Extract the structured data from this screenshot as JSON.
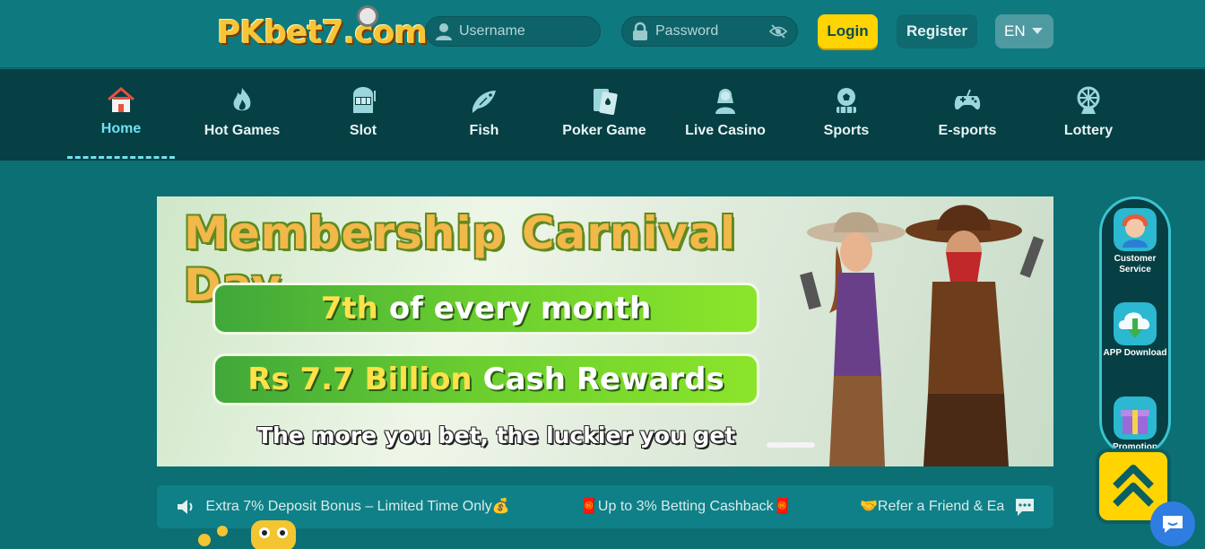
{
  "header": {
    "logo": "PKbet7.com",
    "username_placeholder": "Username",
    "password_placeholder": "Password",
    "login_label": "Login",
    "register_label": "Register",
    "language": "EN"
  },
  "nav": {
    "items": [
      {
        "label": "Home",
        "icon": "home-icon",
        "active": true
      },
      {
        "label": "Hot Games",
        "icon": "flame-icon"
      },
      {
        "label": "Slot",
        "icon": "slot-machine-icon"
      },
      {
        "label": "Fish",
        "icon": "fish-icon"
      },
      {
        "label": "Poker Game",
        "icon": "poker-card-icon"
      },
      {
        "label": "Live Casino",
        "icon": "dealer-icon"
      },
      {
        "label": "Sports",
        "icon": "soccer-ball-icon"
      },
      {
        "label": "E-sports",
        "icon": "gamepad-icon"
      },
      {
        "label": "Lottery",
        "icon": "lottery-wheel-icon"
      }
    ]
  },
  "banner": {
    "title": "Membership Carnival Day",
    "line1_highlight": "7th",
    "line1_rest": "of every month",
    "line2_highlight": "Rs 7.7 Billion",
    "line2_rest": "Cash Rewards",
    "subtitle": "The more you bet, the luckier you get"
  },
  "marquee": {
    "items": [
      "​ Extra 7% Deposit Bonus – Limited Time Only💰",
      "🧧Up to 3% Betting Cashback🧧",
      "🤝Refer a Friend & Ea"
    ]
  },
  "side_panel": {
    "items": [
      {
        "label": "Customer Service",
        "icon": "customer-service-icon"
      },
      {
        "label": "APP Download",
        "icon": "app-download-icon"
      },
      {
        "label": "Promotion",
        "icon": "promotion-gift-icon"
      }
    ]
  },
  "colors": {
    "page_bg": "#0b6f74",
    "nav_bg": "#063f44",
    "accent_active": "#6fe0ef",
    "login_button": "#ffd400",
    "banner_title": "#f2b84a"
  }
}
